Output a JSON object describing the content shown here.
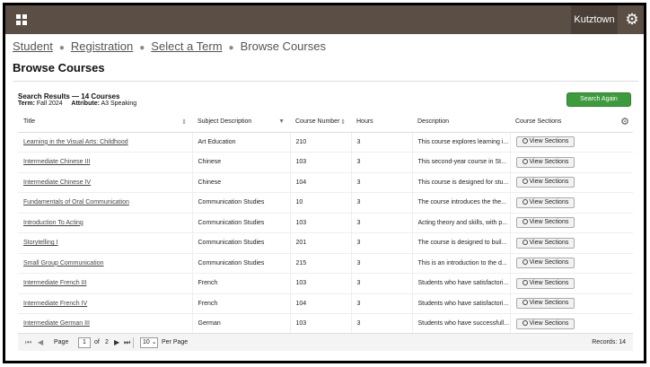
{
  "header": {
    "institution": "Kutztown"
  },
  "breadcrumb": {
    "items": [
      "Student",
      "Registration",
      "Select a Term"
    ],
    "current": "Browse Courses"
  },
  "page_title": "Browse Courses",
  "results": {
    "title": "Search Results",
    "count": "— 14 Courses",
    "term_label": "Term:",
    "term_value": "Fall 2024",
    "attr_label": "Attribute:",
    "attr_value": "A3 Speaking",
    "search_again": "Search Again"
  },
  "table": {
    "columns": [
      "Title",
      "Subject Description",
      "Course Number",
      "Hours",
      "Description",
      "Course Sections"
    ],
    "view_label": "View Sections",
    "rows": [
      {
        "title": "Learning in the Visual Arts: Childhood",
        "subject": "Art Education",
        "number": "210",
        "hours": "3",
        "desc": "This course explores learning i..."
      },
      {
        "title": "Intermediate Chinese III",
        "subject": "Chinese",
        "number": "103",
        "hours": "3",
        "desc": "This second-year course in St..."
      },
      {
        "title": "Intermediate Chinese IV",
        "subject": "Chinese",
        "number": "104",
        "hours": "3",
        "desc": "This course is designed for stu..."
      },
      {
        "title": "Fundamentals of Oral Communication",
        "subject": "Communication Studies",
        "number": "10",
        "hours": "3",
        "desc": "The course introduces the the..."
      },
      {
        "title": "Introduction To Acting",
        "subject": "Communication Studies",
        "number": "103",
        "hours": "3",
        "desc": "Acting theory and skills, with p..."
      },
      {
        "title": "Storytelling I",
        "subject": "Communication Studies",
        "number": "201",
        "hours": "3",
        "desc": "The course is designed to buil..."
      },
      {
        "title": "Small Group Communication",
        "subject": "Communication Studies",
        "number": "215",
        "hours": "3",
        "desc": "This is an introduction to the d..."
      },
      {
        "title": "Intermediate French III",
        "subject": "French",
        "number": "103",
        "hours": "3",
        "desc": "Students who have satisfactori..."
      },
      {
        "title": "Intermediate French IV",
        "subject": "French",
        "number": "104",
        "hours": "3",
        "desc": "Students who have satisfactori..."
      },
      {
        "title": "Intermediate German III",
        "subject": "German",
        "number": "103",
        "hours": "3",
        "desc": "Students who have successfull..."
      }
    ]
  },
  "pager": {
    "page_label": "Page",
    "page_value": "1",
    "of_label": "of",
    "total_pages": "2",
    "page_size": "10",
    "per_page_label": "Per Page",
    "records": "Records: 14"
  }
}
